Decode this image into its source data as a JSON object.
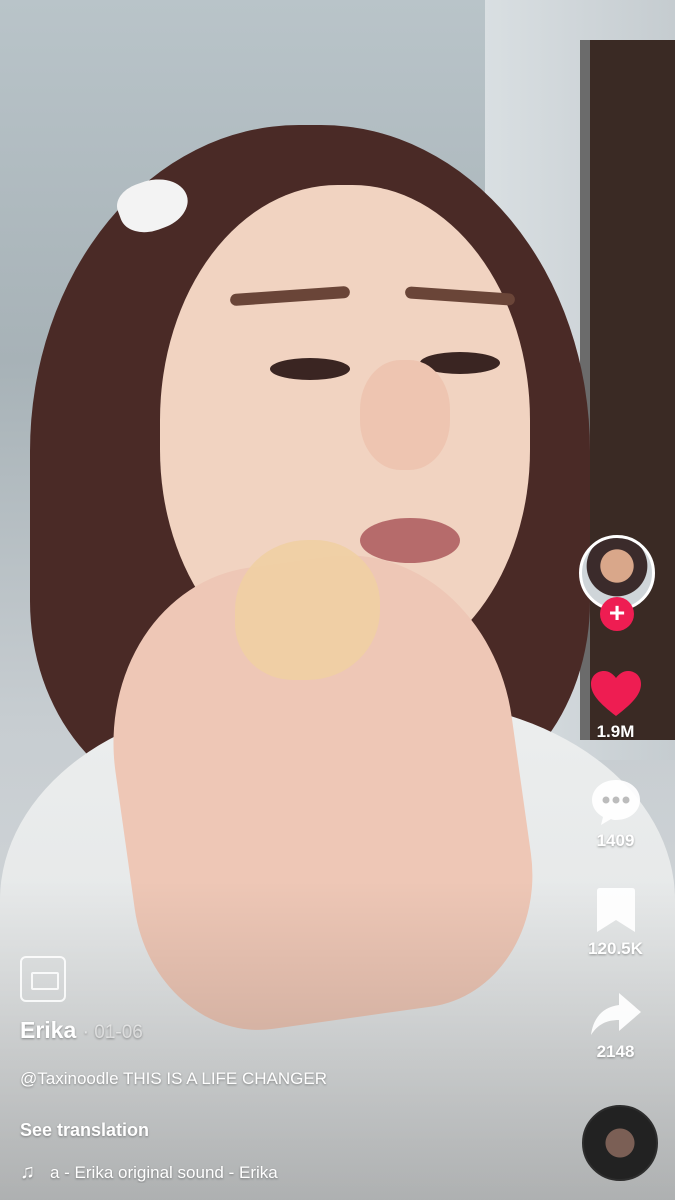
{
  "video": {
    "author": "Erika",
    "date": "01-06",
    "description": "@Taxinoodle THIS IS A LIFE CHANGER",
    "see_translation": "See translation",
    "music_text": "a - Erika    original sound - Erika"
  },
  "rail": {
    "likes": "1.9M",
    "comments": "1409",
    "saves": "120.5K",
    "shares": "2148",
    "follow_symbol": "+"
  },
  "icons": {
    "captions": "captions-icon",
    "like": "heart-icon",
    "comment": "comment-bubble-icon",
    "save": "bookmark-icon",
    "share": "share-arrow-icon",
    "music": "music-note-icon",
    "disc": "music-disc-icon"
  },
  "colors": {
    "like_red": "#ee1d52",
    "text": "#ffffff"
  }
}
